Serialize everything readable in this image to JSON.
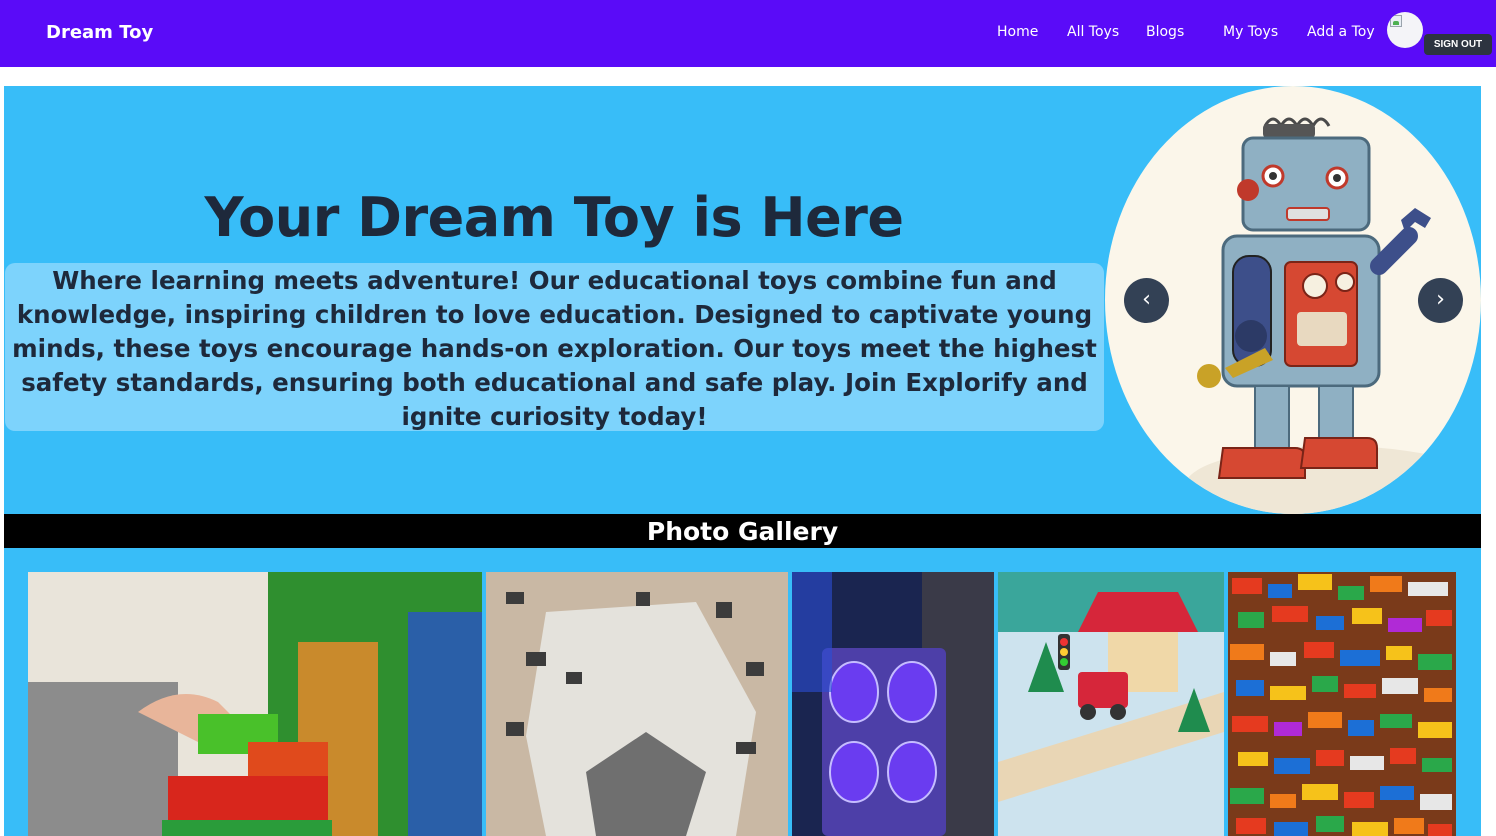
{
  "navbar": {
    "brand": "Dream Toy",
    "links": [
      "Home",
      "All Toys",
      "Blogs",
      "My Toys",
      "Add a Toy"
    ],
    "signout": "SIGN OUT",
    "bg": "#5a0bf8"
  },
  "hero": {
    "title": "Your Dream Toy is Here",
    "description": "Where learning meets adventure! Our educational toys combine fun and knowledge, inspiring children to love education. Designed to captivate young minds, these toys encourage hands-on exploration. Our toys meet the highest safety standards, ensuring both educational and safe play. Join Explorify and ignite curiosity today!",
    "bg": "#38bdf8",
    "prev": "‹",
    "next": "›"
  },
  "gallery": {
    "title": "Photo Gallery"
  }
}
